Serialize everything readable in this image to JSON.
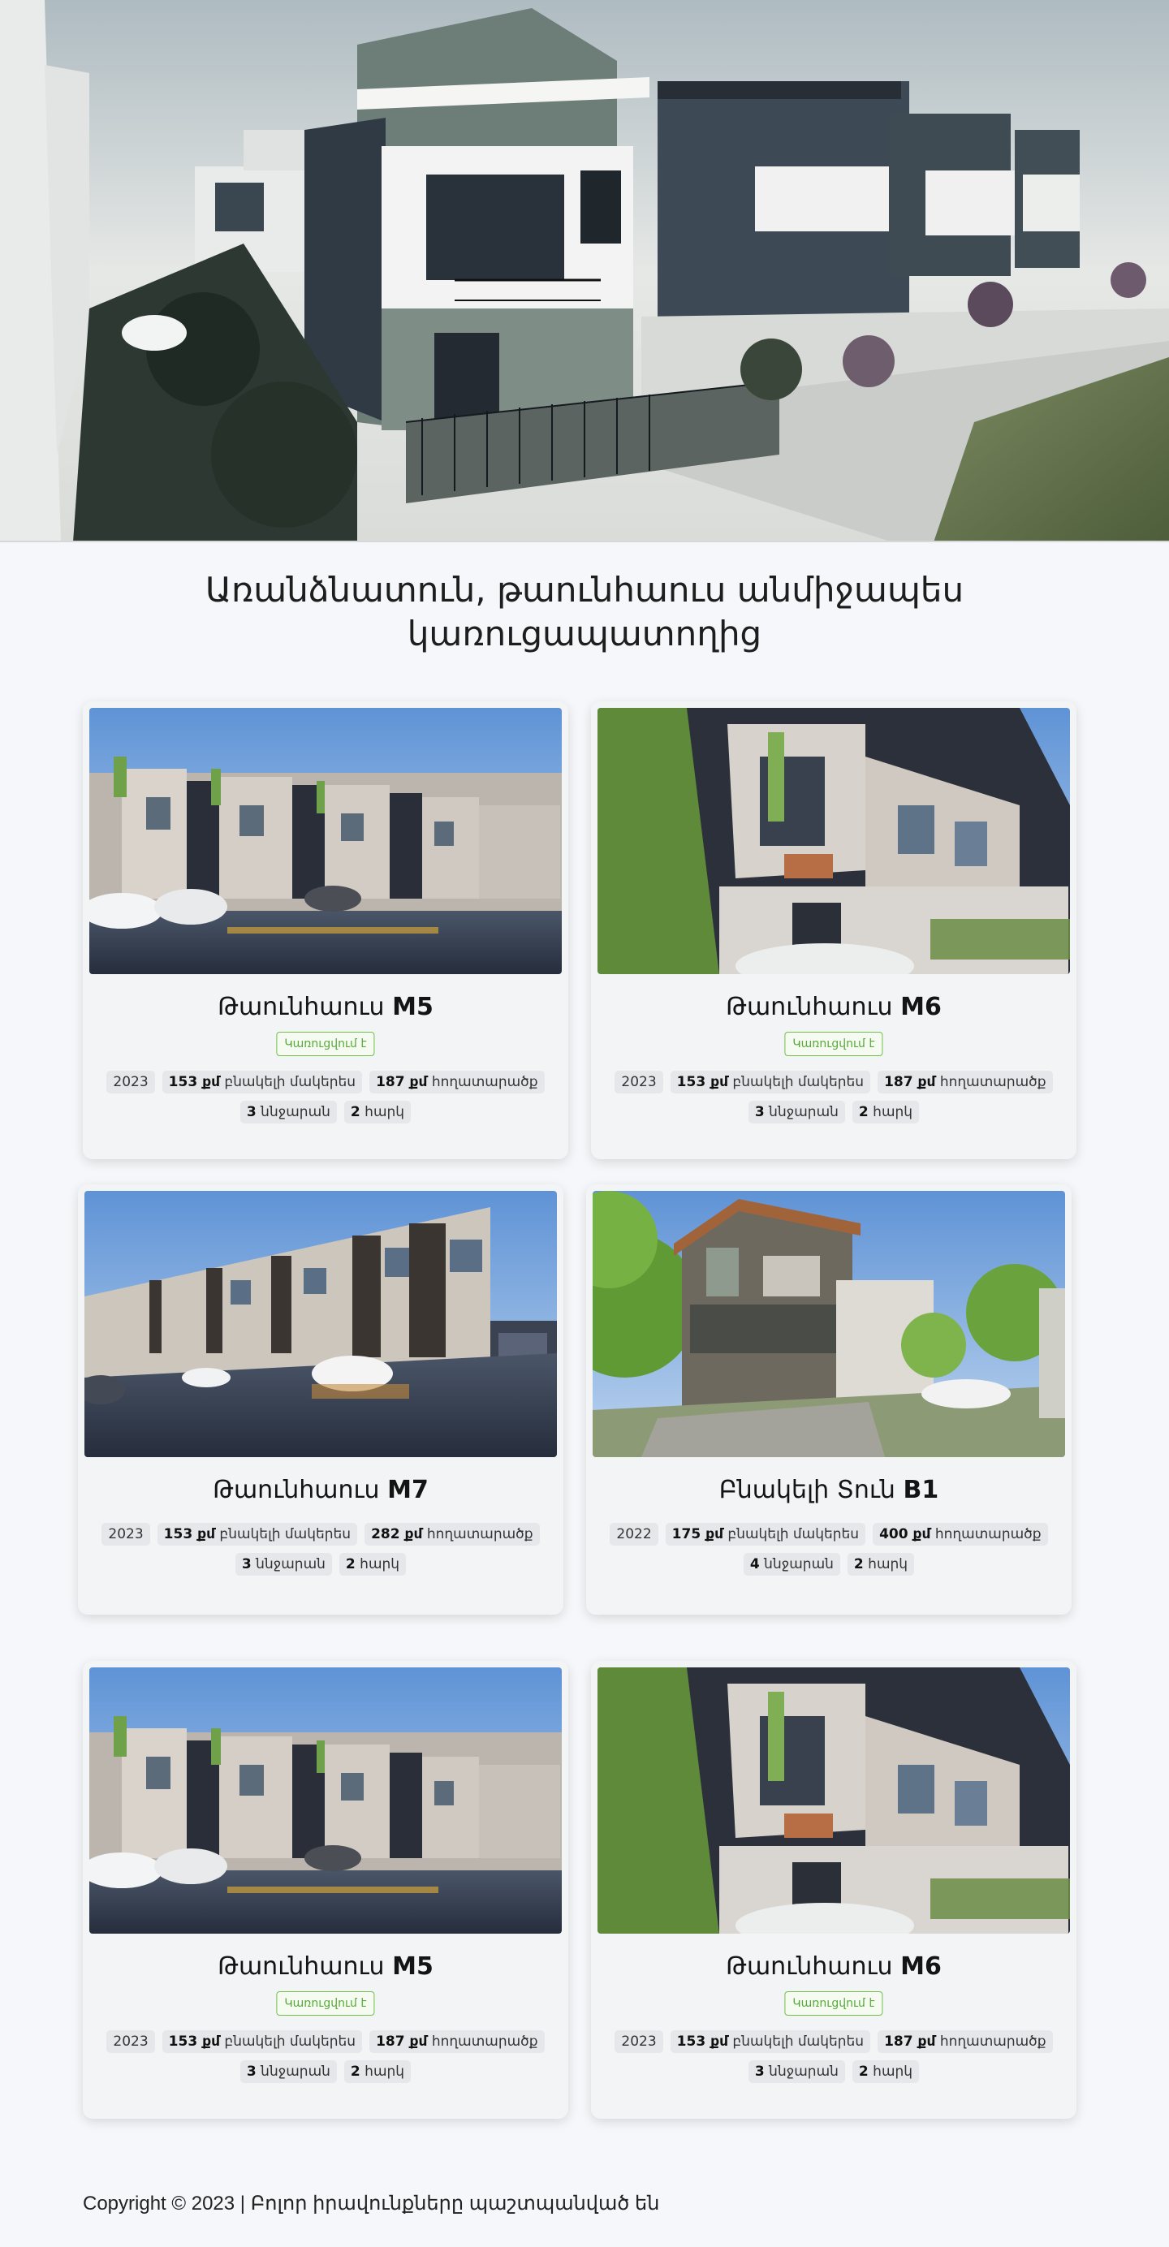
{
  "hero": {
    "image": "modern-townhouse-complex-render"
  },
  "heading": "Առանձնատուն, թաունհաուս անմիջապես կառուցապատողից",
  "cards": [
    {
      "title_prefix": "Թաունհաուս",
      "title_code": "M5",
      "status": "Կառուցվում է",
      "year": "2023",
      "living_value": "153 քմ",
      "living_label": "բնակելի մակերես",
      "land_value": "187 քմ",
      "land_label": "հողատարածք",
      "rooms_value": "3",
      "rooms_label": "ննջարան",
      "floors_value": "2",
      "floors_label": "հարկ"
    },
    {
      "title_prefix": "Թաունհաուս",
      "title_code": "M6",
      "status": "Կառուցվում է",
      "year": "2023",
      "living_value": "153 քմ",
      "living_label": "բնակելի մակերես",
      "land_value": "187 քմ",
      "land_label": "հողատարածք",
      "rooms_value": "3",
      "rooms_label": "ննջարան",
      "floors_value": "2",
      "floors_label": "հարկ"
    },
    {
      "title_prefix": "Թաունհաուս",
      "title_code": "M7",
      "status": "",
      "year": "2023",
      "living_value": "153 քմ",
      "living_label": "բնակելի մակերես",
      "land_value": "282 քմ",
      "land_label": "հողատարածք",
      "rooms_value": "3",
      "rooms_label": "ննջարան",
      "floors_value": "2",
      "floors_label": "հարկ"
    },
    {
      "title_prefix": "Բնակելի Տուն",
      "title_code": "B1",
      "status": "",
      "year": "2022",
      "living_value": "175 քմ",
      "living_label": "բնակելի մակերես",
      "land_value": "400 քմ",
      "land_label": "հողատարածք",
      "rooms_value": "4",
      "rooms_label": "ննջարան",
      "floors_value": "2",
      "floors_label": "հարկ"
    },
    {
      "title_prefix": "Թաունհաուս",
      "title_code": "M5",
      "status": "Կառուցվում է",
      "year": "2023",
      "living_value": "153 քմ",
      "living_label": "բնակելի մակերես",
      "land_value": "187 քմ",
      "land_label": "հողատարածք",
      "rooms_value": "3",
      "rooms_label": "ննջարան",
      "floors_value": "2",
      "floors_label": "հարկ"
    },
    {
      "title_prefix": "Թաունհաուս",
      "title_code": "M6",
      "status": "Կառուցվում է",
      "year": "2023",
      "living_value": "153 քմ",
      "living_label": "բնակելի մակերես",
      "land_value": "187 քմ",
      "land_label": "հողատարածք",
      "rooms_value": "3",
      "rooms_label": "ննջարան",
      "floors_value": "2",
      "floors_label": "հարկ"
    }
  ],
  "footer": "Copyright © 2023 | Բոլոր իրավունքները պաշտպանված են",
  "colors": {
    "status_border": "#6fbf4a",
    "status_text": "#58a83a",
    "page_bg": "#f5f7fa",
    "card_bg": "#f3f4f6"
  }
}
